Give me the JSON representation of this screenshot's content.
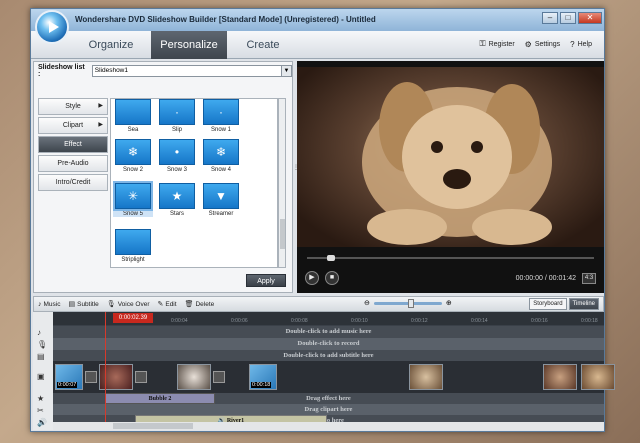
{
  "window": {
    "title": "Wondershare DVD Slideshow Builder [Standard Mode] (Unregistered) - Untitled"
  },
  "nav": {
    "tabs": [
      "Organize",
      "Personalize",
      "Create"
    ],
    "active": "Personalize"
  },
  "toplinks": {
    "register": "Register",
    "settings": "Settings",
    "help": "Help"
  },
  "slideshow_list": {
    "label": "Slideshow list :",
    "value": "Slideshow1"
  },
  "sidemenu": [
    {
      "label": "Style",
      "arrow": "▶"
    },
    {
      "label": "Clipart",
      "arrow": "▶"
    },
    {
      "label": "Effect"
    },
    {
      "label": "Pre-Audio"
    },
    {
      "label": "Intro/Credit"
    }
  ],
  "effects": [
    {
      "name": "Sea",
      "glyph": ""
    },
    {
      "name": "Slip",
      "glyph": "·"
    },
    {
      "name": "Snow 1",
      "glyph": "·"
    },
    {
      "name": "Snow 2",
      "glyph": "❄"
    },
    {
      "name": "Snow 3",
      "glyph": "•"
    },
    {
      "name": "Snow 4",
      "glyph": "❄"
    },
    {
      "name": "Snow 5",
      "glyph": "✳"
    },
    {
      "name": "Stars",
      "glyph": "★"
    },
    {
      "name": "Streamer",
      "glyph": "▼"
    },
    {
      "name": "Striplight",
      "glyph": ""
    }
  ],
  "apply_label": "Apply",
  "player": {
    "time": "00:00:00 / 00:01:42",
    "play": "▶",
    "stop": "■",
    "expand": "4:3"
  },
  "timeline_toolbar": {
    "music": "Music",
    "subtitle": "Subtitle",
    "voice_over": "Voice Over",
    "edit": "Edit",
    "delete": "Delete",
    "storyboard": "Storyboard",
    "timeline": "Timeline"
  },
  "timeline": {
    "playhead_time": "0:00:02.39",
    "ruler": [
      "0:00:04",
      "0:00:06",
      "0:00:08",
      "0:00:10",
      "0:00:12",
      "0:00:14",
      "0:00:16",
      "0:00:18"
    ],
    "music_hint": "Double-click to add music here",
    "record_hint": "Double-click to record",
    "subtitle_hint": "Double-click to add subtitle here",
    "effect_hint": "Drag effect here",
    "clipart_hint": "Drag clipart here",
    "audio_hint": "Audio here",
    "bubble_label": "Bubble 2",
    "river_label": "River1",
    "clip_durations": [
      "0:00:07",
      "0:00:18"
    ],
    "slider_level": 0.5
  },
  "colors": {
    "accent": "#3e454d",
    "playhead": "#c8281e"
  }
}
